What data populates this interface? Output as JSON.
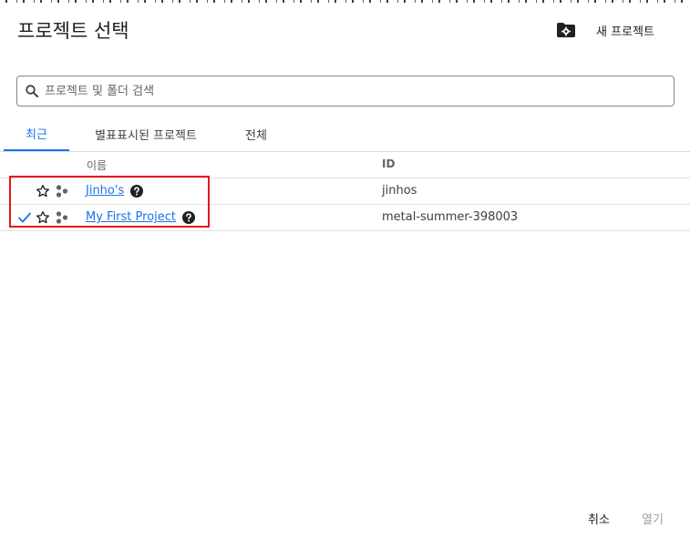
{
  "dialog": {
    "title": "프로젝트 선택",
    "new_project_label": "새 프로젝트"
  },
  "search": {
    "placeholder": "프로젝트 및 폴더 검색",
    "value": ""
  },
  "tabs": [
    {
      "label": "최근",
      "active": true
    },
    {
      "label": "별표표시된 프로젝트",
      "active": false
    },
    {
      "label": "전체",
      "active": false
    }
  ],
  "table": {
    "columns": {
      "name": "이름",
      "id": "ID"
    },
    "rows": [
      {
        "name": "Jinho's",
        "id": "jinhos",
        "selected": false
      },
      {
        "name": "My First Project",
        "id": "metal-summer-398003",
        "selected": true
      }
    ]
  },
  "footer": {
    "cancel_label": "취소",
    "open_label": "열기"
  },
  "colors": {
    "accent": "#1a73e8",
    "highlight": "#e8141c",
    "disabled": "#9aa0a6"
  }
}
